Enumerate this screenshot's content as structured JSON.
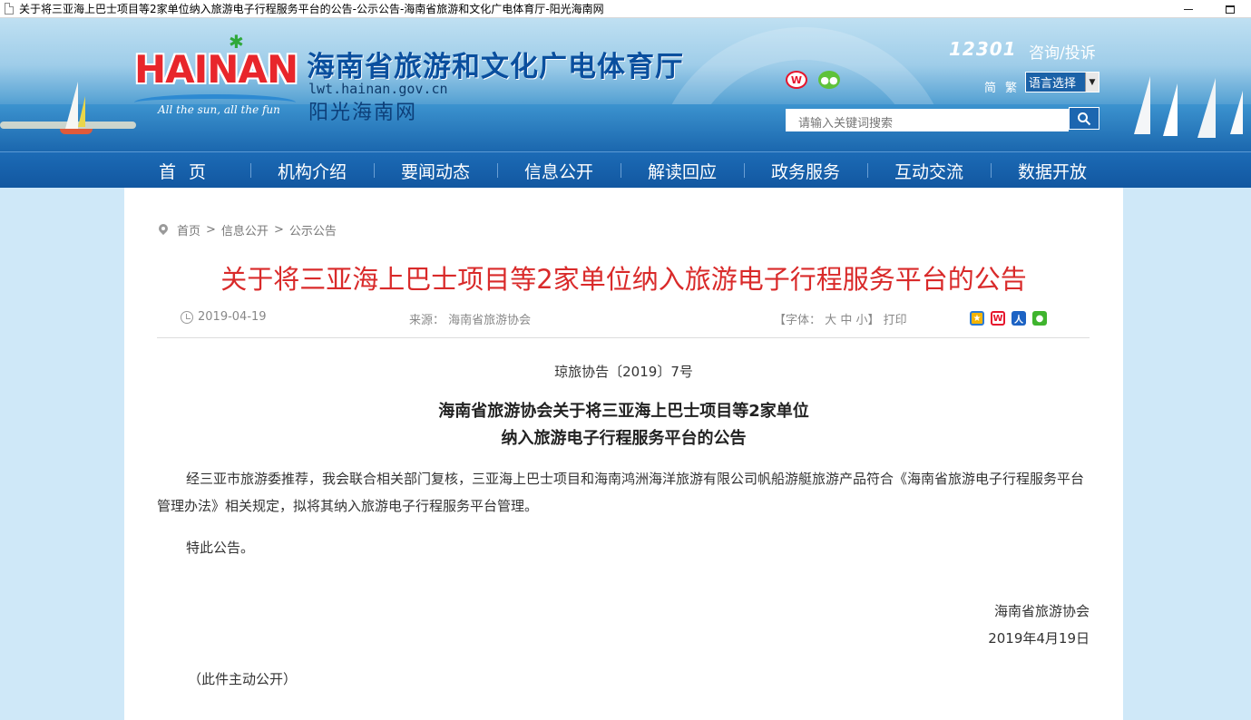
{
  "window": {
    "title": "关于将三亚海上巴士项目等2家单位纳入旅游电子行程服务平台的公告-公示公告-海南省旅游和文化广电体育厅-阳光海南网",
    "minimize_label": "",
    "maximize_label": ""
  },
  "header": {
    "logo_text": "HAINAN",
    "logo_slogan": "All the sun, all the fun",
    "site_name": "海南省旅游和文化广电体育厅",
    "site_url": "lwt.hainan.gov.cn",
    "site_subtitle": "阳光海南网",
    "hotline": "12301",
    "consult_label": "咨询/投诉",
    "social": {
      "weibo_icon": "weibo-icon",
      "wechat_icon": "wechat-icon"
    },
    "lang_simplified": "简",
    "lang_traditional": "繁",
    "lang_select_value": "语言选择",
    "search_placeholder": "请输入关键词搜索"
  },
  "nav": {
    "items": [
      {
        "label": "首页"
      },
      {
        "label": "机构介绍"
      },
      {
        "label": "要闻动态"
      },
      {
        "label": "信息公开"
      },
      {
        "label": "解读回应"
      },
      {
        "label": "政务服务"
      },
      {
        "label": "互动交流"
      },
      {
        "label": "数据开放"
      }
    ]
  },
  "breadcrumb": {
    "items": [
      "首页",
      "信息公开",
      "公示公告"
    ],
    "separator": ">"
  },
  "article": {
    "title": "关于将三亚海上巴士项目等2家单位纳入旅游电子行程服务平台的公告",
    "date": "2019-04-19",
    "source_label": "来源：",
    "source": "海南省旅游协会",
    "font_size_prefix": "【字体：",
    "font_large": "大",
    "font_medium": "中",
    "font_small": "小",
    "font_size_suffix": "】",
    "print_label": "打印",
    "doc_number": "琼旅协告〔2019〕7号",
    "subtitle_line1": "海南省旅游协会关于将三亚海上巴士项目等2家单位",
    "subtitle_line2": "纳入旅游电子行程服务平台的公告",
    "paragraph1": "经三亚市旅游委推荐，我会联合相关部门复核，三亚海上巴士项目和海南鸿洲海洋旅游有限公司帆船游艇旅游产品符合《海南省旅游电子行程服务平台管理办法》相关规定，拟将其纳入旅游电子行程服务平台管理。",
    "paragraph2": "特此公告。",
    "signature_org": "海南省旅游协会",
    "signature_date": "2019年4月19日",
    "open_note": "（此件主动公开）"
  },
  "colors": {
    "nav_bg": "#1a63ad",
    "title_red": "#d92a2a",
    "site_name_blue": "#0a4f9e"
  }
}
